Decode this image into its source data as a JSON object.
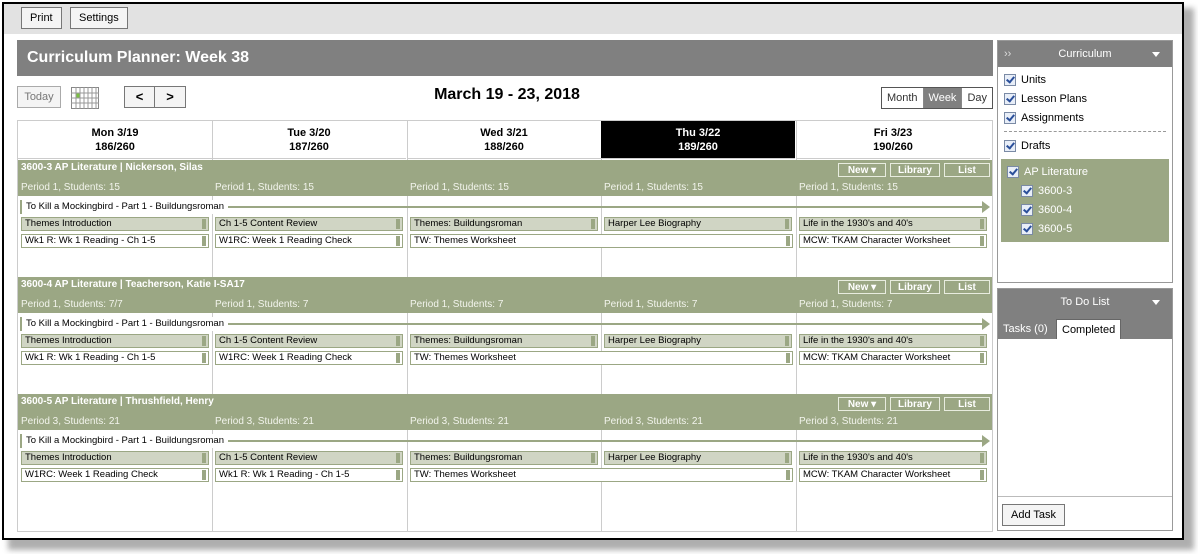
{
  "toolbar": {
    "print": "Print",
    "settings": "Settings"
  },
  "title": "Curriculum Planner: Week 38",
  "nav": {
    "today": "Today",
    "prev": "<",
    "next": ">",
    "date_range": "March 19 - 23, 2018"
  },
  "views": [
    {
      "label": "Month",
      "active": false
    },
    {
      "label": "Week",
      "active": true
    },
    {
      "label": "Day",
      "active": false
    }
  ],
  "days": [
    {
      "label": "Mon 3/19",
      "count": "186/260",
      "today": false
    },
    {
      "label": "Tue 3/20",
      "count": "187/260",
      "today": false
    },
    {
      "label": "Wed 3/21",
      "count": "188/260",
      "today": false
    },
    {
      "label": "Thu 3/22",
      "count": "189/260",
      "today": true
    },
    {
      "label": "Fri 3/23",
      "count": "190/260",
      "today": false
    }
  ],
  "section_buttons": {
    "new": "New ▾",
    "library": "Library",
    "list": "List"
  },
  "sections": [
    {
      "title": "3600-3 AP Literature | Nickerson, Silas",
      "periods": [
        "Period 1, Students: 15",
        "Period 1, Students: 15",
        "Period 1, Students: 15",
        "Period 1, Students: 15",
        "Period 1, Students: 15"
      ],
      "unit": "To Kill a Mockingbird - Part 1 - Buildungsroman",
      "lessons": [
        "Themes Introduction",
        "Ch 1-5 Content Review",
        "Themes: Buildungsroman",
        "Harper Lee Biography",
        "Life in the 1930's and 40's"
      ],
      "assignments": [
        {
          "label": "Wk1 R: Wk 1 Reading - Ch 1-5",
          "start": 0,
          "span": 1
        },
        {
          "label": "W1RC: Week 1 Reading Check",
          "start": 1,
          "span": 1
        },
        {
          "label": "TW: Themes Worksheet",
          "start": 2,
          "span": 2
        },
        {
          "label": "MCW: TKAM Character Worksheet",
          "start": 4,
          "span": 1
        }
      ]
    },
    {
      "title": "3600-4 AP Literature | Teacherson, Katie I-SA17",
      "periods": [
        "Period 1, Students: 7/7",
        "Period 1, Students: 7",
        "Period 1, Students: 7",
        "Period 1, Students: 7",
        "Period 1, Students: 7"
      ],
      "unit": "To Kill a Mockingbird - Part 1 - Buildungsroman",
      "lessons": [
        "Themes Introduction",
        "Ch 1-5 Content Review",
        "Themes: Buildungsroman",
        "Harper Lee Biography",
        "Life in the 1930's and 40's"
      ],
      "assignments": [
        {
          "label": "Wk1 R: Wk 1 Reading - Ch 1-5",
          "start": 0,
          "span": 1
        },
        {
          "label": "W1RC: Week 1 Reading Check",
          "start": 1,
          "span": 1
        },
        {
          "label": "TW: Themes Worksheet",
          "start": 2,
          "span": 2
        },
        {
          "label": "MCW: TKAM Character Worksheet",
          "start": 4,
          "span": 1
        }
      ]
    },
    {
      "title": "3600-5 AP Literature | Thrushfield, Henry",
      "periods": [
        "Period 3, Students: 21",
        "Period 3, Students: 21",
        "Period 3, Students: 21",
        "Period 3, Students: 21",
        "Period 3, Students: 21"
      ],
      "unit": "To Kill a Mockingbird - Part 1 - Buildungsroman",
      "lessons": [
        "Themes Introduction",
        "Ch 1-5 Content Review",
        "Themes: Buildungsroman",
        "Harper Lee Biography",
        "Life in the 1930's and 40's"
      ],
      "assignments": [
        {
          "label": "W1RC: Week 1 Reading Check",
          "start": 0,
          "span": 1
        },
        {
          "label": "Wk1 R: Wk 1 Reading - Ch 1-5",
          "start": 1,
          "span": 1
        },
        {
          "label": "TW: Themes Worksheet",
          "start": 2,
          "span": 2
        },
        {
          "label": "MCW: TKAM Character Worksheet",
          "start": 4,
          "span": 1
        }
      ]
    }
  ],
  "curriculum_panel": {
    "title": "Curriculum",
    "filters": [
      {
        "label": "Units",
        "checked": true
      },
      {
        "label": "Lesson Plans",
        "checked": true
      },
      {
        "label": "Assignments",
        "checked": true
      }
    ],
    "drafts": {
      "label": "Drafts",
      "checked": true
    },
    "course": {
      "label": "AP Literature",
      "checked": true,
      "sections": [
        {
          "label": "3600-3",
          "checked": true
        },
        {
          "label": "3600-4",
          "checked": true
        },
        {
          "label": "3600-5",
          "checked": true
        }
      ]
    }
  },
  "todo_panel": {
    "title": "To Do List",
    "tabs": [
      {
        "label": "Tasks (0)",
        "active": false
      },
      {
        "label": "Completed",
        "active": true
      }
    ],
    "add_task": "Add Task"
  },
  "colors": {
    "section_green": "#9ba784",
    "lesson_bg": "#d0d5c4",
    "header_gray": "#808080",
    "today_bg": "#000000"
  }
}
